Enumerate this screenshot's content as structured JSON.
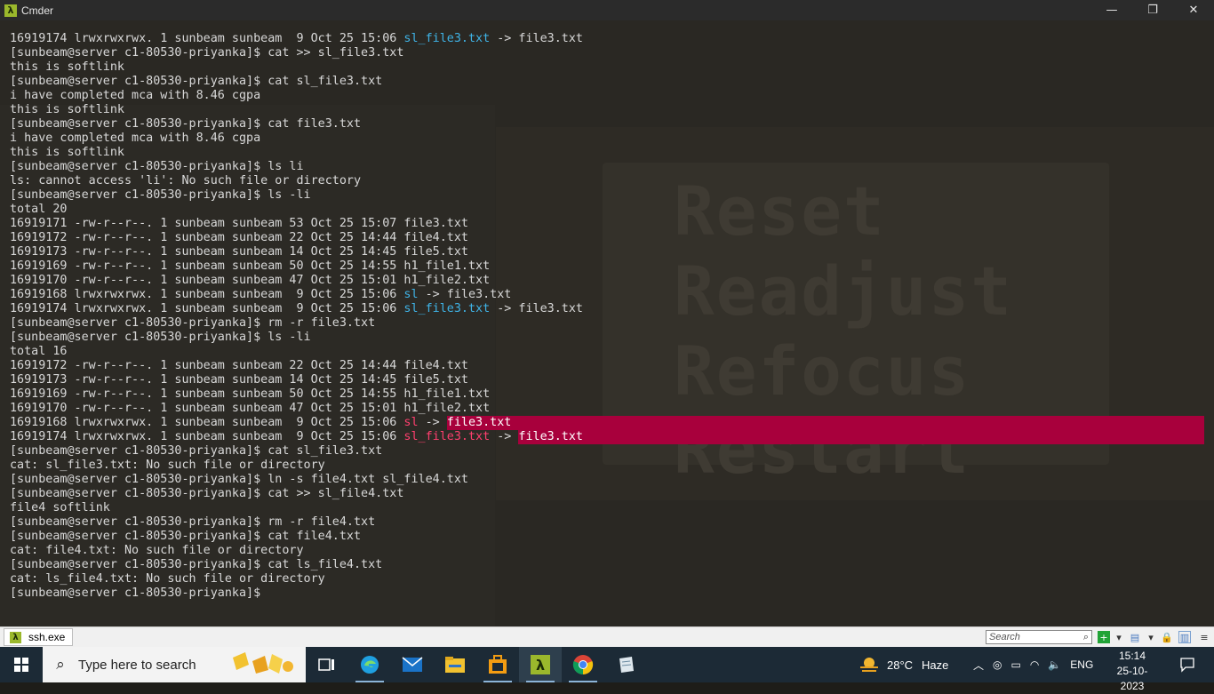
{
  "window": {
    "title": "Cmder",
    "minimize_glyph": "—",
    "maximize_glyph": "❐",
    "close_glyph": "✕"
  },
  "background": {
    "words": [
      "Reset",
      "Readjust",
      "Refocus",
      "Restart"
    ]
  },
  "terminal": {
    "lines": [
      {
        "segments": [
          {
            "t": "16919174 lrwxrwxrwx. 1 sunbeam sunbeam  9 Oct 25 15:06 "
          },
          {
            "t": "sl_file3.txt",
            "c": "link"
          },
          {
            "t": " -> file3.txt"
          }
        ]
      },
      {
        "segments": [
          {
            "t": "[sunbeam@server c1-80530-priyanka]$ cat >> sl_file3.txt"
          }
        ]
      },
      {
        "segments": [
          {
            "t": "this is softlink"
          }
        ]
      },
      {
        "segments": [
          {
            "t": "[sunbeam@server c1-80530-priyanka]$ cat sl_file3.txt"
          }
        ]
      },
      {
        "segments": [
          {
            "t": "i have completed mca with 8.46 cgpa"
          }
        ]
      },
      {
        "segments": [
          {
            "t": "this is softlink"
          }
        ]
      },
      {
        "segments": [
          {
            "t": "[sunbeam@server c1-80530-priyanka]$ cat file3.txt"
          }
        ]
      },
      {
        "segments": [
          {
            "t": "i have completed mca with 8.46 cgpa"
          }
        ]
      },
      {
        "segments": [
          {
            "t": "this is softlink"
          }
        ]
      },
      {
        "segments": [
          {
            "t": "[sunbeam@server c1-80530-priyanka]$ ls li"
          }
        ]
      },
      {
        "segments": [
          {
            "t": "ls: cannot access 'li': No such file or directory"
          }
        ]
      },
      {
        "segments": [
          {
            "t": "[sunbeam@server c1-80530-priyanka]$ ls -li"
          }
        ]
      },
      {
        "segments": [
          {
            "t": "total 20"
          }
        ]
      },
      {
        "segments": [
          {
            "t": "16919171 -rw-r--r--. 1 sunbeam sunbeam 53 Oct 25 15:07 file3.txt"
          }
        ]
      },
      {
        "segments": [
          {
            "t": "16919172 -rw-r--r--. 1 sunbeam sunbeam 22 Oct 25 14:44 file4.txt"
          }
        ]
      },
      {
        "segments": [
          {
            "t": "16919173 -rw-r--r--. 1 sunbeam sunbeam 14 Oct 25 14:45 file5.txt"
          }
        ]
      },
      {
        "segments": [
          {
            "t": "16919169 -rw-r--r--. 1 sunbeam sunbeam 50 Oct 25 14:55 h1_file1.txt"
          }
        ]
      },
      {
        "segments": [
          {
            "t": "16919170 -rw-r--r--. 1 sunbeam sunbeam 47 Oct 25 15:01 h1_file2.txt"
          }
        ]
      },
      {
        "segments": [
          {
            "t": "16919168 lrwxrwxrwx. 1 sunbeam sunbeam  9 Oct 25 15:06 "
          },
          {
            "t": "sl",
            "c": "link"
          },
          {
            "t": " -> file3.txt"
          }
        ]
      },
      {
        "segments": [
          {
            "t": "16919174 lrwxrwxrwx. 1 sunbeam sunbeam  9 Oct 25 15:06 "
          },
          {
            "t": "sl_file3.txt",
            "c": "link"
          },
          {
            "t": " -> file3.txt"
          }
        ]
      },
      {
        "segments": [
          {
            "t": "[sunbeam@server c1-80530-priyanka]$ rm -r file3.txt"
          }
        ]
      },
      {
        "segments": [
          {
            "t": "[sunbeam@server c1-80530-priyanka]$ ls -li"
          }
        ]
      },
      {
        "segments": [
          {
            "t": "total 16"
          }
        ]
      },
      {
        "segments": [
          {
            "t": "16919172 -rw-r--r--. 1 sunbeam sunbeam 22 Oct 25 14:44 file4.txt"
          }
        ]
      },
      {
        "segments": [
          {
            "t": "16919173 -rw-r--r--. 1 sunbeam sunbeam 14 Oct 25 14:45 file5.txt"
          }
        ]
      },
      {
        "segments": [
          {
            "t": "16919169 -rw-r--r--. 1 sunbeam sunbeam 50 Oct 25 14:55 h1_file1.txt"
          }
        ]
      },
      {
        "segments": [
          {
            "t": "16919170 -rw-r--r--. 1 sunbeam sunbeam 47 Oct 25 15:01 h1_file2.txt"
          }
        ]
      },
      {
        "highlight": true,
        "segments": [
          {
            "t": "16919168 lrwxrwxrwx. 1 sunbeam sunbeam  9 Oct 25 15:06 "
          },
          {
            "t": "sl",
            "c": "broken"
          },
          {
            "t": " -> "
          },
          {
            "t": "file3.txt",
            "c": "target"
          }
        ]
      },
      {
        "highlight": true,
        "segments": [
          {
            "t": "16919174 lrwxrwxrwx. 1 sunbeam sunbeam  9 Oct 25 15:06 "
          },
          {
            "t": "sl_file3.txt",
            "c": "broken"
          },
          {
            "t": " -> "
          },
          {
            "t": "file3.txt",
            "c": "target"
          }
        ]
      },
      {
        "segments": [
          {
            "t": "[sunbeam@server c1-80530-priyanka]$ cat sl_file3.txt"
          }
        ]
      },
      {
        "segments": [
          {
            "t": "cat: sl_file3.txt: No such file or directory"
          }
        ]
      },
      {
        "segments": [
          {
            "t": "[sunbeam@server c1-80530-priyanka]$ ln -s file4.txt sl_file4.txt"
          }
        ]
      },
      {
        "segments": [
          {
            "t": "[sunbeam@server c1-80530-priyanka]$ cat >> sl_file4.txt"
          }
        ]
      },
      {
        "segments": [
          {
            "t": "file4 softlink"
          }
        ]
      },
      {
        "segments": [
          {
            "t": "[sunbeam@server c1-80530-priyanka]$ rm -r file4.txt"
          }
        ]
      },
      {
        "segments": [
          {
            "t": "[sunbeam@server c1-80530-priyanka]$ cat file4.txt"
          }
        ]
      },
      {
        "segments": [
          {
            "t": "cat: file4.txt: No such file or directory"
          }
        ]
      },
      {
        "segments": [
          {
            "t": "[sunbeam@server c1-80530-priyanka]$ cat ls_file4.txt"
          }
        ]
      },
      {
        "segments": [
          {
            "t": "cat: ls_file4.txt: No such file or directory"
          }
        ]
      },
      {
        "segments": [
          {
            "t": "[sunbeam@server c1-80530-priyanka]$ "
          }
        ]
      }
    ],
    "colors": {
      "link": "#3fb3e6",
      "broken": "#ff3f6e",
      "highlight": "#a8003c",
      "text": "#d8d8d8"
    }
  },
  "cmder_bar": {
    "tab_label": "ssh.exe",
    "tab_icon": "lambda-icon",
    "search_placeholder": "Search"
  },
  "taskbar": {
    "search_placeholder": "Type here to search",
    "apps": [
      {
        "name": "task-view-icon",
        "glyph": "⧉"
      },
      {
        "name": "edge-icon",
        "glyph": "e"
      },
      {
        "name": "mail-icon",
        "glyph": "✉"
      },
      {
        "name": "file-explorer-icon",
        "glyph": "▭"
      },
      {
        "name": "store-icon",
        "glyph": "▣"
      },
      {
        "name": "cmder-icon",
        "glyph": "λ"
      },
      {
        "name": "chrome-icon",
        "glyph": "◉"
      },
      {
        "name": "notepad-icon",
        "glyph": "✎"
      }
    ],
    "weather": {
      "temp": "28°C",
      "condition": "Haze",
      "icon": "sun-haze-icon"
    },
    "tray": {
      "language": "ENG"
    },
    "clock": {
      "time": "15:14",
      "date": "25-10-2023"
    }
  }
}
